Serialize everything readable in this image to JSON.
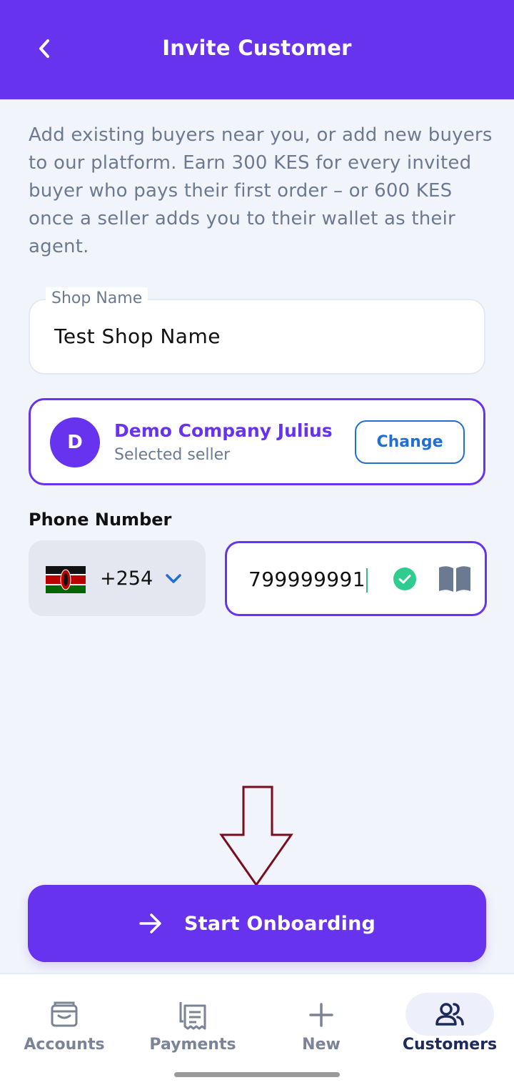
{
  "header": {
    "title": "Invite Customer"
  },
  "intro_text": "Add existing buyers near you, or add new buyers to our platform. Earn 300 KES for every invited buyer who pays their first order – or 600 KES once a seller adds you to their wallet as their agent.",
  "shop_field": {
    "label": "Shop Name",
    "value": "Test Shop Name"
  },
  "seller": {
    "avatar_initial": "D",
    "name": "Demo Company Julius",
    "subtitle": "Selected seller",
    "change_label": "Change"
  },
  "phone": {
    "label": "Phone Number",
    "country_code": "+254",
    "country_flag": "kenya-flag-icon",
    "value": "799999991"
  },
  "primary_action": {
    "label": "Start Onboarding",
    "icon": "arrow-right-icon"
  },
  "bottom_nav": {
    "items": [
      {
        "label": "Accounts",
        "icon": "wallet-icon"
      },
      {
        "label": "Payments",
        "icon": "receipt-icon"
      },
      {
        "label": "New",
        "icon": "plus-icon"
      },
      {
        "label": "Customers",
        "icon": "users-icon",
        "active": true
      }
    ]
  },
  "colors": {
    "brand": "#6833EE",
    "link": "#1F6FD6",
    "success": "#2ECC8F",
    "nav_active": "#1D2A5B",
    "annotation": "#7A0C1E"
  }
}
